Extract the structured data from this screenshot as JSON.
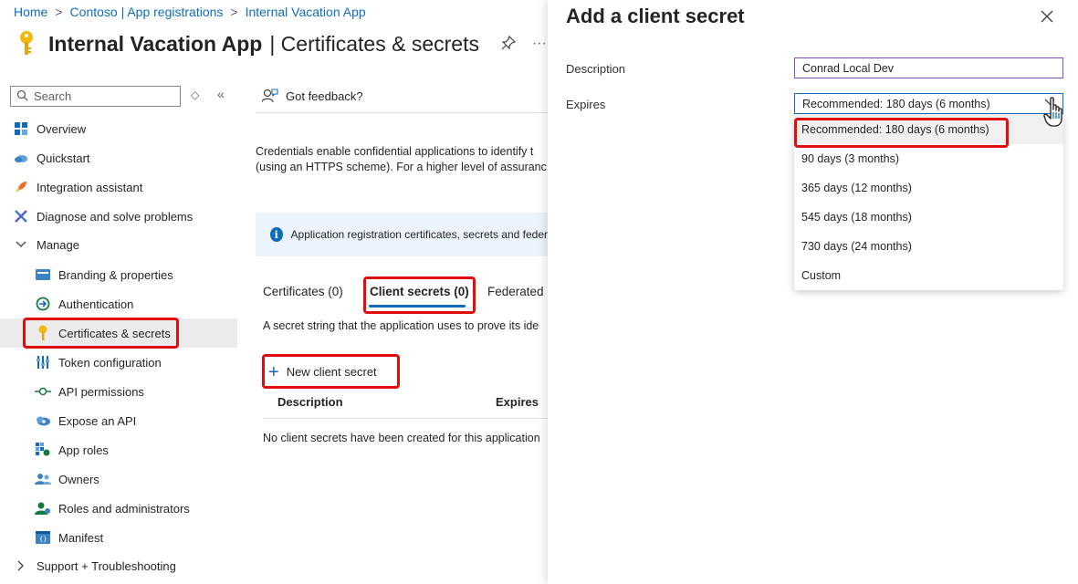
{
  "breadcrumb": [
    "Home",
    "Contoso | App registrations",
    "Internal Vacation App"
  ],
  "header": {
    "app_name": "Internal Vacation App",
    "page_name": "| Certificates & secrets",
    "more": "···"
  },
  "sidebar": {
    "search_placeholder": "Search",
    "items": [
      {
        "label": "Overview",
        "icon": "overview-icon"
      },
      {
        "label": "Quickstart",
        "icon": "quickstart-icon"
      },
      {
        "label": "Integration assistant",
        "icon": "rocket-icon"
      },
      {
        "label": "Diagnose and solve problems",
        "icon": "wrench-icon"
      },
      {
        "label": "Manage",
        "icon": "chevron-down-icon"
      },
      {
        "label": "Branding & properties",
        "icon": "branding-icon"
      },
      {
        "label": "Authentication",
        "icon": "authentication-icon"
      },
      {
        "label": "Certificates & secrets",
        "icon": "key-icon"
      },
      {
        "label": "Token configuration",
        "icon": "token-icon"
      },
      {
        "label": "API permissions",
        "icon": "api-permissions-icon"
      },
      {
        "label": "Expose an API",
        "icon": "cloud-icon"
      },
      {
        "label": "App roles",
        "icon": "app-roles-icon"
      },
      {
        "label": "Owners",
        "icon": "owners-icon"
      },
      {
        "label": "Roles and administrators",
        "icon": "roles-icon"
      },
      {
        "label": "Manifest",
        "icon": "manifest-icon"
      },
      {
        "label": "Support + Troubleshooting",
        "icon": "chevron-right-icon"
      }
    ]
  },
  "main": {
    "feedback": "Got feedback?",
    "description_line1": "Credentials enable confidential applications to identify t",
    "description_line2": "(using an HTTPS scheme). For a higher level of assuranc",
    "info_text": "Application registration certificates, secrets and feder",
    "tabs": [
      {
        "label": "Certificates (0)"
      },
      {
        "label": "Client secrets (0)"
      },
      {
        "label": "Federated"
      }
    ],
    "secret_description": "A secret string that the application uses to prove its ide",
    "new_secret_button": "New client secret",
    "columns": [
      "Description",
      "Expires"
    ],
    "empty_text": "No client secrets have been created for this application"
  },
  "panel": {
    "title": "Add a client secret",
    "description_label": "Description",
    "description_value": "Conrad Local Dev",
    "expires_label": "Expires",
    "expires_value": "Recommended: 180 days (6 months)",
    "options": [
      "Recommended: 180 days (6 months)",
      "90 days (3 months)",
      "365 days (12 months)",
      "545 days (18 months)",
      "730 days (24 months)",
      "Custom"
    ]
  },
  "colors": {
    "accent": "#0f6cbd",
    "highlight": "#e00d0d",
    "key_gold": "#f2b80d"
  }
}
